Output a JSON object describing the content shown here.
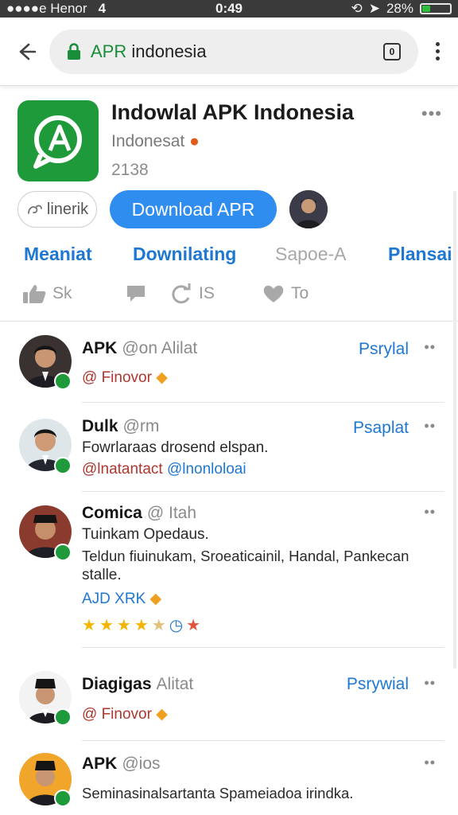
{
  "status_bar": {
    "carrier": "●●●●e Henor",
    "signal": "4",
    "time": "0:49",
    "battery_text": "28%",
    "battery_level": 0.28
  },
  "browser": {
    "url_prefix": "APR",
    "url_rest": " indonesia",
    "tab_count": "0"
  },
  "app": {
    "title": "Indowlal APK Indonesia",
    "developer": "Indonesat",
    "count": "2138",
    "secondary_button": "linerik",
    "primary_button": "Download  APR"
  },
  "tabs": [
    "Meaniat",
    "Downilating",
    "Sapoe-A",
    "Plansai"
  ],
  "reactions": [
    "Sk",
    "",
    "IS",
    "To"
  ],
  "posts": [
    {
      "name": "APK",
      "handle": "@on Alilat",
      "follow": "Psrylal",
      "lines": [
        "Finovor"
      ]
    },
    {
      "name": "Dulk",
      "handle": "@rm",
      "follow": "Psaplat",
      "lines": [
        "Fowrlaraas drosend elspan.",
        "@lnatantact",
        "@lnonloloai"
      ]
    },
    {
      "name": "Comica",
      "handle": "@ Itah",
      "follow": "",
      "lines": [
        "Tuinkam Opedaus.",
        "Teldun fiuinukam, Sroeaticainil, Handal, Pankecan",
        "stalle.",
        "AJD XRK"
      ],
      "rating": 4
    },
    {
      "name": "Diagigas",
      "handle": "Alitat",
      "follow": "Psrywial",
      "lines": [
        "Finovor"
      ]
    },
    {
      "name": "APK",
      "handle": "@ios",
      "follow": "",
      "lines": [
        "Seminasinalsartanta Spameiadoa irindka."
      ]
    }
  ]
}
